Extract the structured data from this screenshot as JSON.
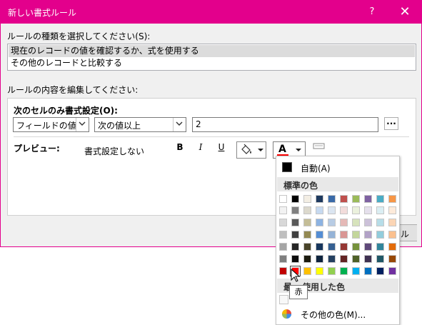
{
  "window": {
    "title": "新しい書式ルール",
    "help": "?",
    "close": "✕"
  },
  "rule_type": {
    "label": "ルールの種類を選択してください(S):",
    "items": [
      {
        "label": "現在のレコードの値を確認するか、式を使用する",
        "selected": true
      },
      {
        "label": "その他のレコードと比較する",
        "selected": false
      }
    ]
  },
  "edit": {
    "label": "ルールの内容を編集してください:",
    "section_title": "次のセルのみ書式設定(O):",
    "field_combo": "フィールドの値",
    "operator_combo": "次の値以上",
    "value": "2",
    "ellipsis": "...",
    "preview_label": "プレビュー:",
    "preview_text": "書式設定しない",
    "bold": "B",
    "italic": "I",
    "underline": "U",
    "font_color_letter": "A"
  },
  "buttons": {
    "cancel_partial": "ル"
  },
  "palette": {
    "auto": "自動(A)",
    "standard_header": "標準の色",
    "recent_header": "最近使用した色",
    "recent_header_visible": "最",
    "recent_header_tail": "使用した色",
    "more": "その他の色(M)...",
    "tooltip": "赤",
    "rows": [
      [
        "#ffffff",
        "#000000",
        "#f3eee4",
        "#1f3a5f",
        "#3a6aa8",
        "#bf504d",
        "#9bbb59",
        "#7f62a2",
        "#4aacc5",
        "#f79646"
      ],
      [
        "#f2f2f2",
        "#808080",
        "#dcd9cd",
        "#c6d9f0",
        "#dbe5f1",
        "#f2dcdb",
        "#ebf1dd",
        "#e5e0ec",
        "#dbeef3",
        "#fdeada"
      ],
      [
        "#d8d8d8",
        "#595959",
        "#c4bd97",
        "#8db3e2",
        "#b8cce4",
        "#e5b9b7",
        "#d7e3bc",
        "#ccc1d9",
        "#b7dde8",
        "#fbd5b5"
      ],
      [
        "#bfbfbf",
        "#3f3f3f",
        "#938953",
        "#548dd4",
        "#95b3d7",
        "#d99694",
        "#c3d69b",
        "#b2a2c7",
        "#92cddc",
        "#fac08f"
      ],
      [
        "#a5a5a5",
        "#262626",
        "#494429",
        "#17365d",
        "#366092",
        "#953734",
        "#76923c",
        "#5f497a",
        "#31859b",
        "#e36c09"
      ],
      [
        "#7f7f7f",
        "#0c0c0c",
        "#1d1b10",
        "#0f243e",
        "#244061",
        "#632423",
        "#4f6128",
        "#3f3151",
        "#205867",
        "#974806"
      ],
      [
        "#c00000",
        "#ff0000",
        "#ffc000",
        "#ffff00",
        "#92d050",
        "#00b050",
        "#00b0f0",
        "#0070c0",
        "#002060",
        "#7030a0"
      ]
    ]
  },
  "colors": {
    "accent": "#e3008c",
    "font_color_bar": "#ff0000"
  }
}
